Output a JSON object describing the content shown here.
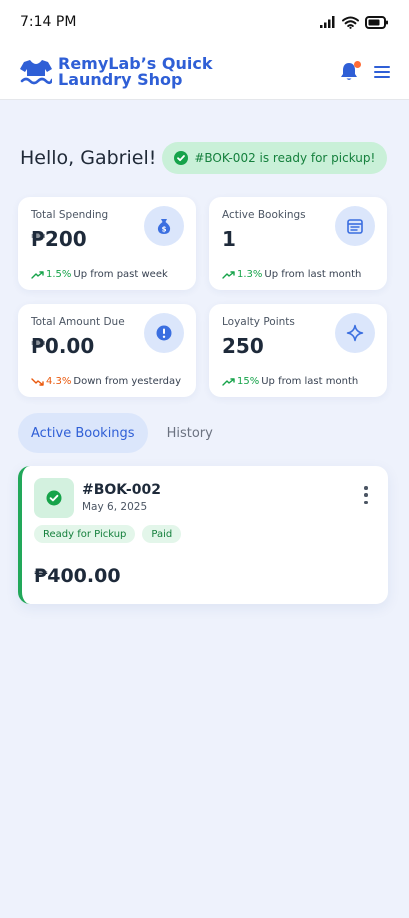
{
  "status_bar": {
    "time": "7:14 PM"
  },
  "header": {
    "title": "RemyLab’s Quick Laundry Shop",
    "logo_icon": "shirt-icon",
    "notification_dot_color": "#ff6b35"
  },
  "greeting": {
    "text": "Hello, Gabriel!",
    "notice": "#BOK-002 is ready for pickup!"
  },
  "stats": [
    {
      "label": "Total Spending",
      "value": "₱200",
      "trend_pct": "1.5%",
      "trend_text": "Up from past week",
      "direction": "up",
      "icon": "money-bag-icon"
    },
    {
      "label": "Active Bookings",
      "value": "1",
      "trend_pct": "1.3%",
      "trend_text": "Up from last month",
      "direction": "up",
      "icon": "calendar-list-icon"
    },
    {
      "label": "Total Amount Due",
      "value": "₱0.00",
      "trend_pct": "4.3%",
      "trend_text": "Down from yesterday",
      "direction": "down",
      "icon": "alert-icon"
    },
    {
      "label": "Loyalty Points",
      "value": "250",
      "trend_pct": "15%",
      "trend_text": "Up from last month",
      "direction": "up",
      "icon": "sparkle-icon"
    }
  ],
  "tabs": [
    {
      "label": "Active Bookings",
      "active": true
    },
    {
      "label": "History",
      "active": false
    }
  ],
  "booking": {
    "id": "#BOK-002",
    "date": "May 6, 2025",
    "badges": [
      "Ready for Pickup",
      "Paid"
    ],
    "amount": "₱400.00"
  },
  "colors": {
    "brand": "#2f5fd6",
    "success": "#16a34a",
    "danger": "#ea580c",
    "background": "#eef2fc"
  }
}
